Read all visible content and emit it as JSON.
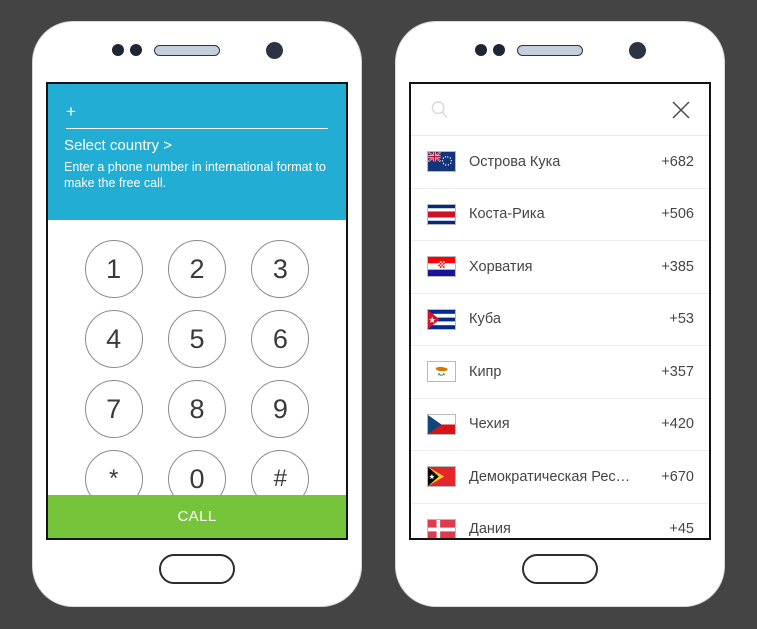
{
  "background_color": "#444444",
  "accent_color": "#21add4",
  "call_color": "#76c43a",
  "dialer": {
    "phone_input_value": "+",
    "select_country_label": "Select country >",
    "hint_text": "Enter a phone number in international format to make the free call.",
    "keys": [
      "1",
      "2",
      "3",
      "4",
      "5",
      "6",
      "7",
      "8",
      "9",
      "*",
      "0",
      "#"
    ],
    "call_label": "CALL"
  },
  "country_picker": {
    "search_placeholder": "",
    "search_value": "",
    "search_icon": "search-icon",
    "close_icon": "close-icon",
    "rows": [
      {
        "name": "Острова Кука",
        "code": "+682",
        "flag": "cook-islands"
      },
      {
        "name": "Коста-Рика",
        "code": "+506",
        "flag": "costa-rica"
      },
      {
        "name": "Хорватия",
        "code": "+385",
        "flag": "croatia"
      },
      {
        "name": "Куба",
        "code": "+53",
        "flag": "cuba"
      },
      {
        "name": "Кипр",
        "code": "+357",
        "flag": "cyprus"
      },
      {
        "name": "Чехия",
        "code": "+420",
        "flag": "czechia"
      },
      {
        "name": "Демократическая Рес…",
        "code": "+670",
        "flag": "east-timor"
      },
      {
        "name": "Дания",
        "code": "+45",
        "flag": "denmark"
      }
    ]
  }
}
